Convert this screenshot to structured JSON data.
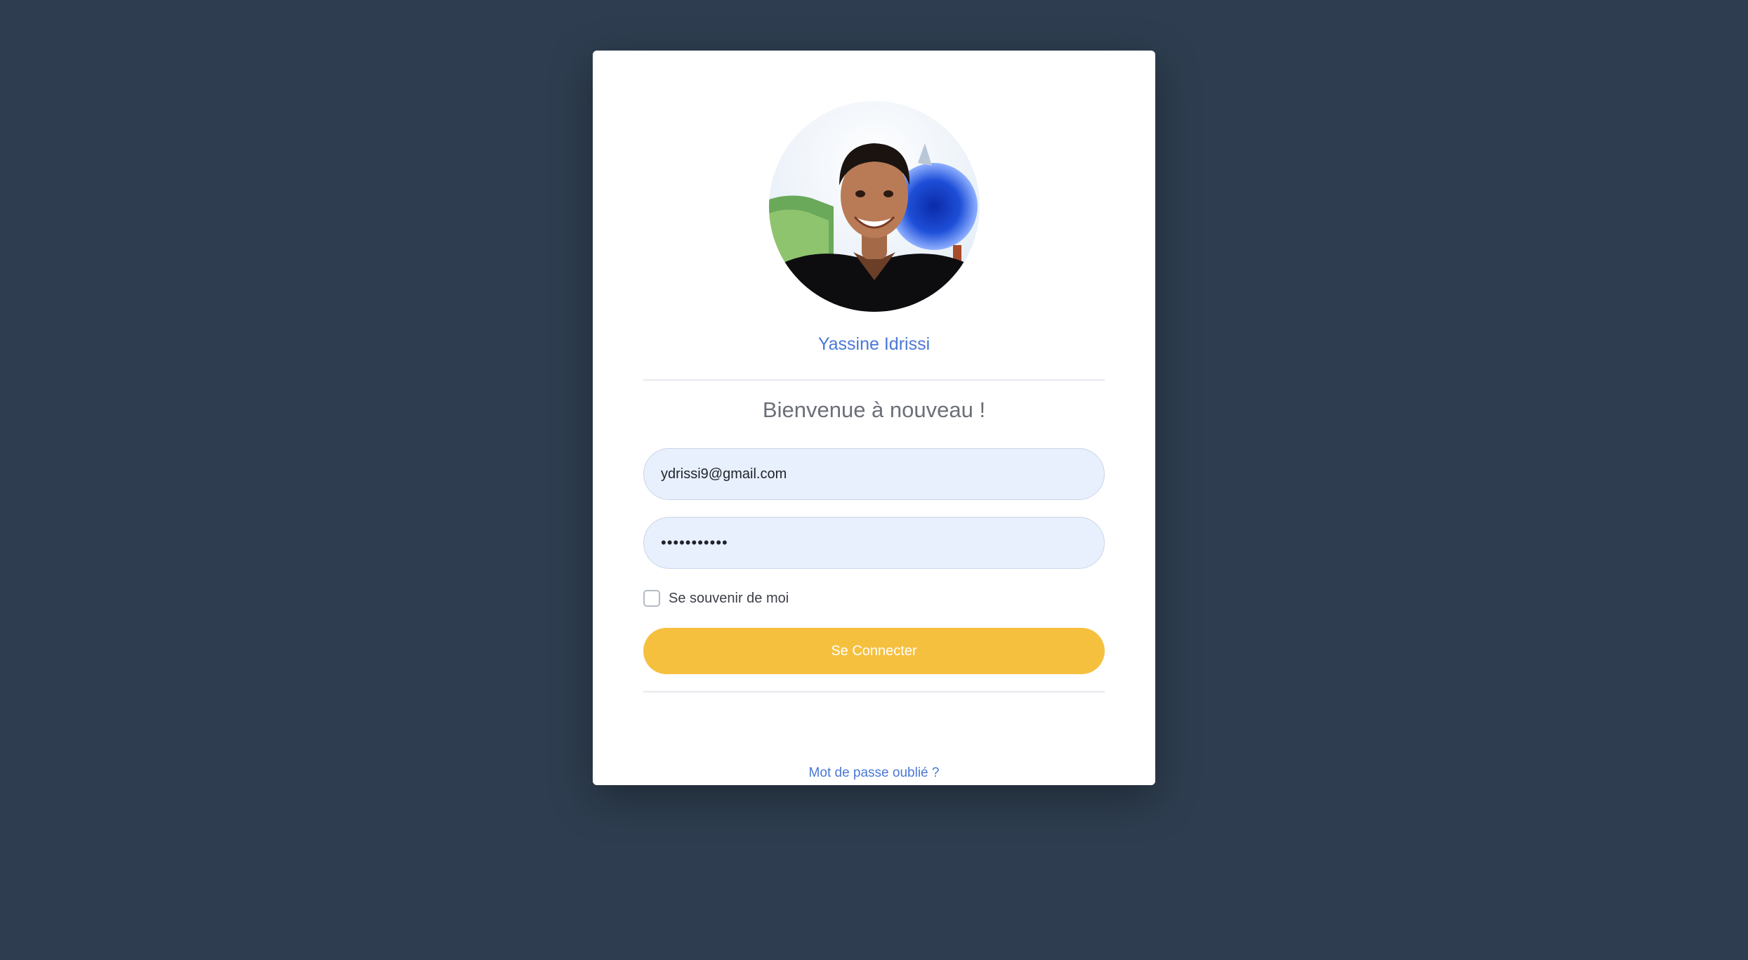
{
  "profile": {
    "name": "Yassine Idrissi"
  },
  "login": {
    "welcome": "Bienvenue à nouveau !",
    "email_value": "ydrissi9@gmail.com",
    "password_value": "•••••••••••",
    "remember_label": "Se souvenir de moi",
    "remember_checked": false,
    "submit_label": "Se Connecter",
    "forgot_label": "Mot de passe oublié ?"
  },
  "colors": {
    "background": "#2e3e50",
    "accent_link": "#4a78d6",
    "button": "#f6c03f",
    "input_fill": "#e8effd"
  }
}
